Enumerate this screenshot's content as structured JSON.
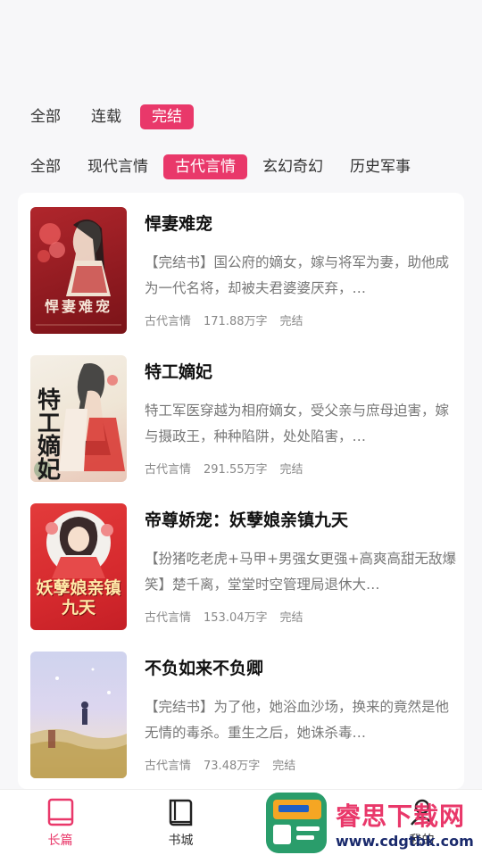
{
  "status_filters": [
    "全部",
    "连载",
    "完结"
  ],
  "status_active": "完结",
  "genre_filters": [
    "全部",
    "现代言情",
    "古代言情",
    "玄幻奇幻",
    "历史军事"
  ],
  "genre_active": "古代言情",
  "books": [
    {
      "title": "悍妻难宠",
      "desc": "【完结书】国公府的嫡女，嫁与将军为妻，助他成为一代名将，却被夫君婆婆厌弃，…",
      "category": "古代言情",
      "words": "171.88万字",
      "status": "完结",
      "cover_text": "悍妻难宠"
    },
    {
      "title": "特工嫡妃",
      "desc": "特工军医穿越为相府嫡女，受父亲与庶母迫害，嫁与摄政王，种种陷阱，处处陷害，…",
      "category": "古代言情",
      "words": "291.55万字",
      "status": "完结",
      "cover_text": "特工嫡妃"
    },
    {
      "title": "帝尊娇宠：妖孽娘亲镇九天",
      "desc": "【扮猪吃老虎+马甲+男强女更强+高爽高甜无敌爆笑】楚千离，堂堂时空管理局退休大…",
      "category": "古代言情",
      "words": "153.04万字",
      "status": "完结",
      "cover_text": "妖孽娘亲镇九天"
    },
    {
      "title": "不负如来不负卿",
      "desc": "【完结书】为了他，她浴血沙场，换来的竟然是他无情的毒杀。重生之后，她诛杀毒…",
      "category": "古代言情",
      "words": "73.48万字",
      "status": "完结",
      "cover_text": ""
    }
  ],
  "tabs": [
    {
      "label": "长篇",
      "icon": "book-icon",
      "active": true
    },
    {
      "label": "书城",
      "icon": "bookshelf-icon",
      "active": false
    },
    {
      "label": "",
      "icon": "grid-icon",
      "active": false
    },
    {
      "label": "我的",
      "icon": "profile-icon",
      "active": false
    }
  ],
  "watermark": {
    "big": "睿思下载网",
    "small": "www.cdgtbk.com"
  },
  "colors": {
    "accent": "#e9386a"
  }
}
